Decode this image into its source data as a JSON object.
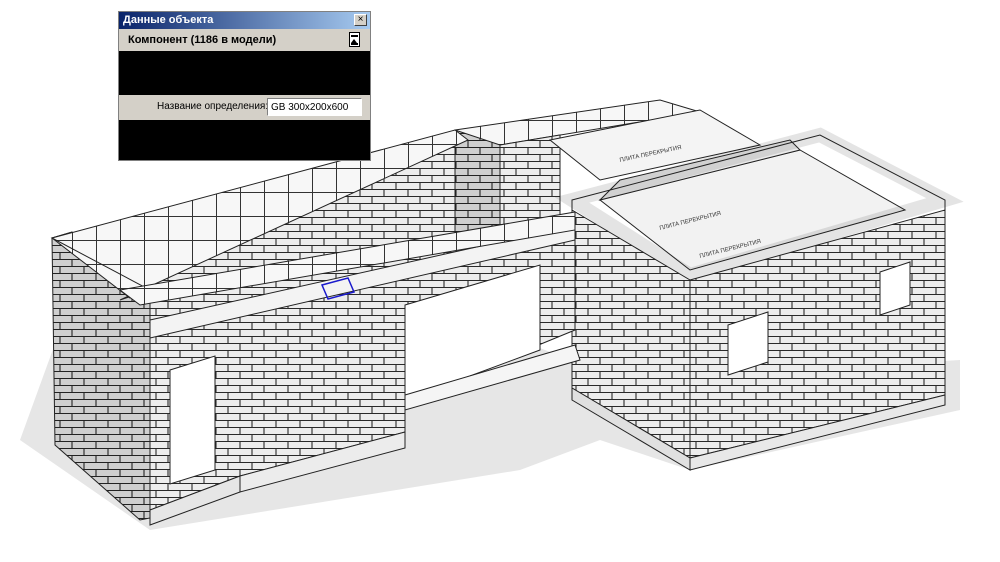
{
  "entity_info": {
    "title": "Данные объекта",
    "close_glyph": "×",
    "component_header": "Компонент (1186 в модели)",
    "definition_label": "Название определения:",
    "definition_value": "GB 300x200x600"
  },
  "colors": {
    "titlebar_start": "#0a246a",
    "titlebar_end": "#a6caf0",
    "dialog_face": "#d4d0c8",
    "selection": "#1a1acc",
    "shadow": "#e6e6e6"
  },
  "icons": [
    "close-icon",
    "collapse-panel-icon"
  ]
}
